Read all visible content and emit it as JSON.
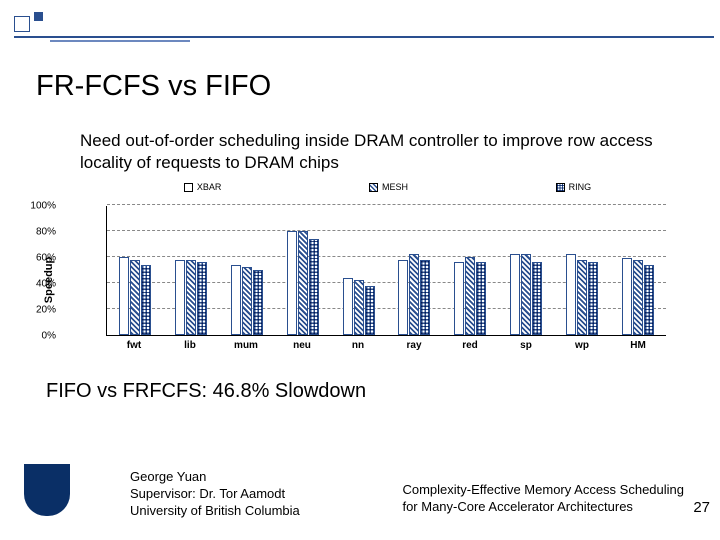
{
  "title": "FR-FCFS vs FIFO",
  "body": "Need out-of-order scheduling inside DRAM controller to improve row access locality of requests to DRAM chips",
  "slowdown": "FIFO vs FRFCFS: 46.8% Slowdown",
  "author": {
    "name": "George Yuan",
    "supervisor": "Supervisor: Dr. Tor Aamodt",
    "affiliation": "University of British Columbia"
  },
  "paper": {
    "l1": "Complexity-Effective Memory Access Scheduling",
    "l2": "for Many-Core Accelerator Architectures"
  },
  "slide_num": "27",
  "chart": {
    "ylabel": "Speedup",
    "legend": [
      "XBAR",
      "MESH",
      "RING"
    ],
    "yticks": [
      "0%",
      "20%",
      "40%",
      "60%",
      "80%",
      "100%"
    ]
  },
  "chart_data": {
    "type": "bar",
    "categories": [
      "fwt",
      "lib",
      "mum",
      "neu",
      "nn",
      "ray",
      "red",
      "sp",
      "wp",
      "HM"
    ],
    "series": [
      {
        "name": "XBAR",
        "values": [
          60,
          58,
          54,
          80,
          44,
          58,
          56,
          62,
          62,
          59
        ]
      },
      {
        "name": "MESH",
        "values": [
          58,
          58,
          52,
          80,
          42,
          62,
          60,
          62,
          58,
          58
        ]
      },
      {
        "name": "RING",
        "values": [
          54,
          56,
          50,
          74,
          38,
          58,
          56,
          56,
          56,
          54
        ]
      }
    ],
    "ylim": [
      0,
      100
    ],
    "ylabel": "Speedup",
    "xlabel": "",
    "title": ""
  }
}
